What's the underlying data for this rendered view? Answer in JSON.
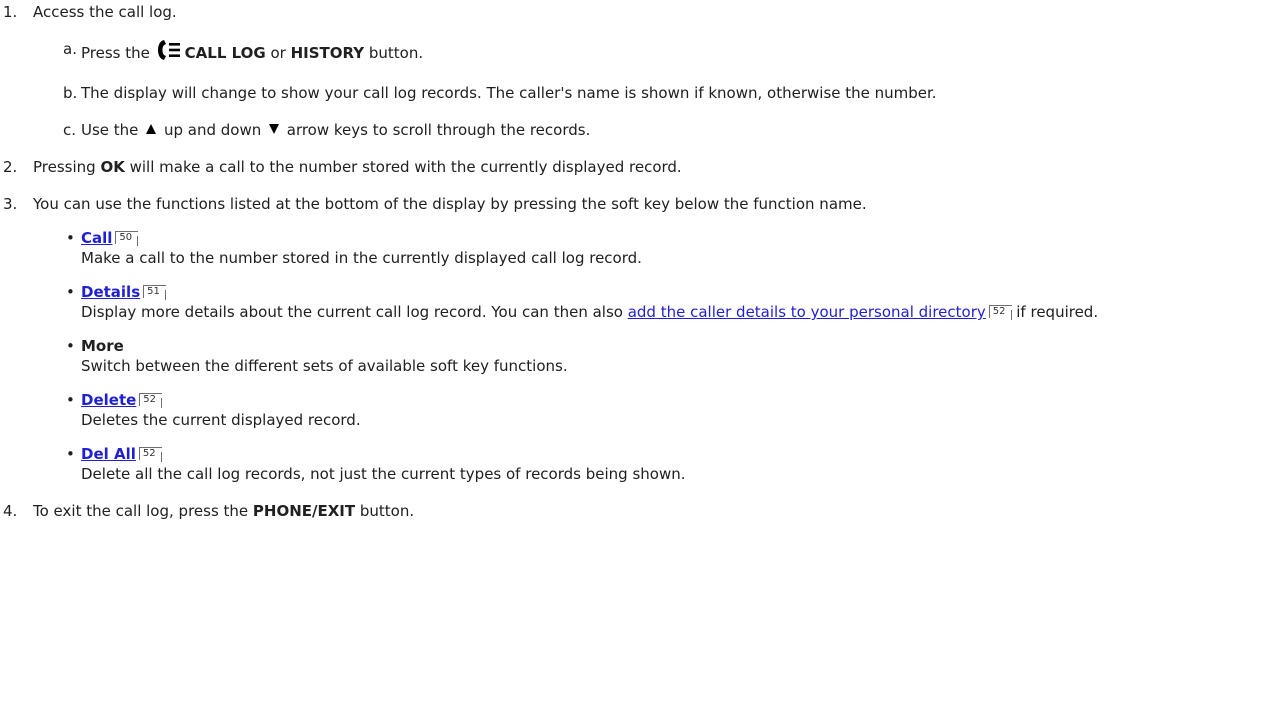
{
  "steps": [
    {
      "num": "1.",
      "text": "Access the call log."
    },
    {
      "num": "2.",
      "pre": "Pressing ",
      "key": "OK",
      "post": " will make a call to the number stored with the currently displayed record."
    },
    {
      "num": "3.",
      "text": "You can use the functions listed at the bottom of the display by pressing the soft key below the function name."
    },
    {
      "num": "4.",
      "pre": "To exit the call log, press the ",
      "key": "PHONE/EXIT",
      "post": " button."
    }
  ],
  "substeps": [
    {
      "num": "a.",
      "pre": "Press the ",
      "icon": "call-log-icon",
      "key1": "CALL LOG",
      "mid": " or ",
      "key2": "HISTORY",
      "post": " button."
    },
    {
      "num": "b.",
      "text": "The display will change to show your call log records. The caller's name is shown if known, otherwise the number."
    },
    {
      "num": "c.",
      "pre": "Use the ",
      "up_icon": "up-arrow-icon",
      "mid": " up and down ",
      "down_icon": "down-arrow-icon",
      "post": " arrow keys to scroll through the records."
    }
  ],
  "functions": [
    {
      "label": "Call",
      "page": "50",
      "desc": "Make a call to the number stored in the currently displayed call log record."
    },
    {
      "label": "Details",
      "page": "51",
      "desc_pre": "Display more details about the current call log record. You can then also ",
      "desc_link": "add the caller details to your personal directory",
      "desc_link_page": "52",
      "desc_post": " if required."
    },
    {
      "label": "More",
      "desc": "Switch between the different sets of available soft key functions."
    },
    {
      "label": "Delete",
      "page": "52",
      "desc": "Deletes the current displayed record."
    },
    {
      "label": "Del All",
      "page": "52",
      "desc": "Delete all the call log records, not just the current types of records being shown."
    }
  ],
  "colors": {
    "link": "#1f1fd6",
    "text": "#202020"
  }
}
